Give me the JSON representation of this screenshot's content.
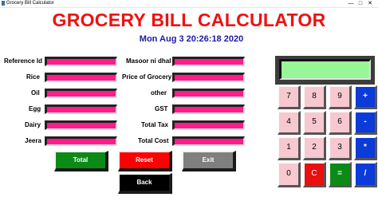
{
  "window": {
    "title": "Grocery Bill Calculator",
    "controls": [
      "—",
      "□",
      "✕"
    ]
  },
  "heading": "GROCERY BILL CALCULATOR",
  "datetime": "Mon Aug  3 20:26:18 2020",
  "left_fields": [
    {
      "label": "Reference Id",
      "value": ""
    },
    {
      "label": "Rice",
      "value": ""
    },
    {
      "label": "Oil",
      "value": ""
    },
    {
      "label": "Egg",
      "value": ""
    },
    {
      "label": "Dairy",
      "value": ""
    },
    {
      "label": "Jeera",
      "value": ""
    }
  ],
  "right_fields": [
    {
      "label": "Masoor ni dhal",
      "value": ""
    },
    {
      "label": "Price of Grocery",
      "value": ""
    },
    {
      "label": "other",
      "value": ""
    },
    {
      "label": "GST",
      "value": ""
    },
    {
      "label": "Total Tax",
      "value": ""
    },
    {
      "label": "Total Cost",
      "value": ""
    }
  ],
  "buttons": {
    "total": "Total",
    "reset": "Reset",
    "exit": "Exit",
    "back": "Back"
  },
  "calculator": {
    "display": "",
    "keys": [
      "7",
      "8",
      "9",
      "+",
      "4",
      "5",
      "6",
      "-",
      "1",
      "2",
      "3",
      "*",
      "0",
      "C",
      "=",
      "/"
    ]
  },
  "colors": {
    "heading": "#ee1111",
    "datetime": "#1a1aa6",
    "field": "#ff1c8d",
    "total_button": "#0c8a16",
    "reset_button": "#ff0000",
    "exit_button": "#7f7f7f",
    "back_button": "#000000",
    "display": "#98f598",
    "number_key": "#f7c8d0",
    "operator_key": "#0b3bd9"
  }
}
